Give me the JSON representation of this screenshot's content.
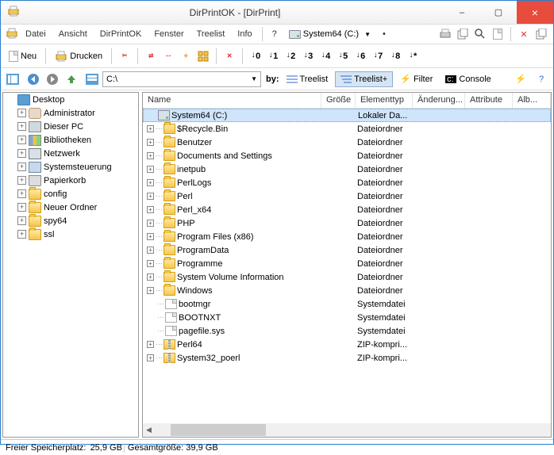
{
  "title": "DirPrintOK - [DirPrint]",
  "window": {
    "min": "–",
    "max": "▢",
    "close": "×"
  },
  "menu": {
    "datei": "Datei",
    "ansicht": "Ansicht",
    "dirprintok": "DirPrintOK",
    "fenster": "Fenster",
    "treelist": "Treelist",
    "info": "Info",
    "help": "?",
    "drive": "System64 (C:)"
  },
  "toolbar": {
    "neu": "Neu",
    "drucken": "Drucken"
  },
  "nav": {
    "by": "by:",
    "path": "C:\\",
    "treelist": "Treelist",
    "treelistplus": "Treelist+",
    "filter": "Filter",
    "console": "Console"
  },
  "tree": [
    {
      "label": "Desktop",
      "icon": "desktop",
      "root": true
    },
    {
      "label": "Administrator",
      "icon": "user"
    },
    {
      "label": "Dieser PC",
      "icon": "pc"
    },
    {
      "label": "Bibliotheken",
      "icon": "lib"
    },
    {
      "label": "Netzwerk",
      "icon": "net"
    },
    {
      "label": "Systemsteuerung",
      "icon": "cp"
    },
    {
      "label": "Papierkorb",
      "icon": "trash"
    },
    {
      "label": "config",
      "icon": "folder"
    },
    {
      "label": "Neuer Ordner",
      "icon": "folder"
    },
    {
      "label": "spy64",
      "icon": "folder"
    },
    {
      "label": "ssl",
      "icon": "folder"
    }
  ],
  "cols": {
    "name": "Name",
    "size": "Größe",
    "type": "Elementtyp",
    "mod": "Änderung...",
    "attr": "Attribute",
    "alb": "Alb..."
  },
  "rows": [
    {
      "name": "System64 (C:)",
      "type": "Lokaler Da...",
      "icon": "drive",
      "exp": false,
      "sel": true,
      "root": true
    },
    {
      "name": "$Recycle.Bin",
      "type": "Dateiordner",
      "icon": "folder",
      "exp": true
    },
    {
      "name": "Benutzer",
      "type": "Dateiordner",
      "icon": "folder",
      "exp": true
    },
    {
      "name": "Documents and Settings",
      "type": "Dateiordner",
      "icon": "folder",
      "exp": true
    },
    {
      "name": "inetpub",
      "type": "Dateiordner",
      "icon": "folder",
      "exp": true
    },
    {
      "name": "PerlLogs",
      "type": "Dateiordner",
      "icon": "folder",
      "exp": true
    },
    {
      "name": "Perl",
      "type": "Dateiordner",
      "icon": "folder",
      "exp": true
    },
    {
      "name": "Perl_x64",
      "type": "Dateiordner",
      "icon": "folder",
      "exp": true
    },
    {
      "name": "PHP",
      "type": "Dateiordner",
      "icon": "folder",
      "exp": true
    },
    {
      "name": "Program Files (x86)",
      "type": "Dateiordner",
      "icon": "folder",
      "exp": true
    },
    {
      "name": "ProgramData",
      "type": "Dateiordner",
      "icon": "folder",
      "exp": true
    },
    {
      "name": "Programme",
      "type": "Dateiordner",
      "icon": "folder",
      "exp": true
    },
    {
      "name": "System Volume Information",
      "type": "Dateiordner",
      "icon": "folder",
      "exp": true
    },
    {
      "name": "Windows",
      "type": "Dateiordner",
      "icon": "folder",
      "exp": true
    },
    {
      "name": "bootmgr",
      "type": "Systemdatei",
      "icon": "file",
      "exp": false
    },
    {
      "name": "BOOTNXT",
      "type": "Systemdatei",
      "icon": "file",
      "exp": false
    },
    {
      "name": "pagefile.sys",
      "type": "Systemdatei",
      "icon": "file",
      "exp": false
    },
    {
      "name": "Perl64",
      "type": "ZIP-kompri...",
      "icon": "zip",
      "exp": true
    },
    {
      "name": "System32_poerl",
      "type": "ZIP-kompri...",
      "icon": "zip",
      "exp": true
    }
  ],
  "status": {
    "free_label": "Freier Speicherplatz:",
    "free_val": "25,9 GB",
    "total_label": "Gesamtgröße:",
    "total_val": "39,9 GB"
  }
}
